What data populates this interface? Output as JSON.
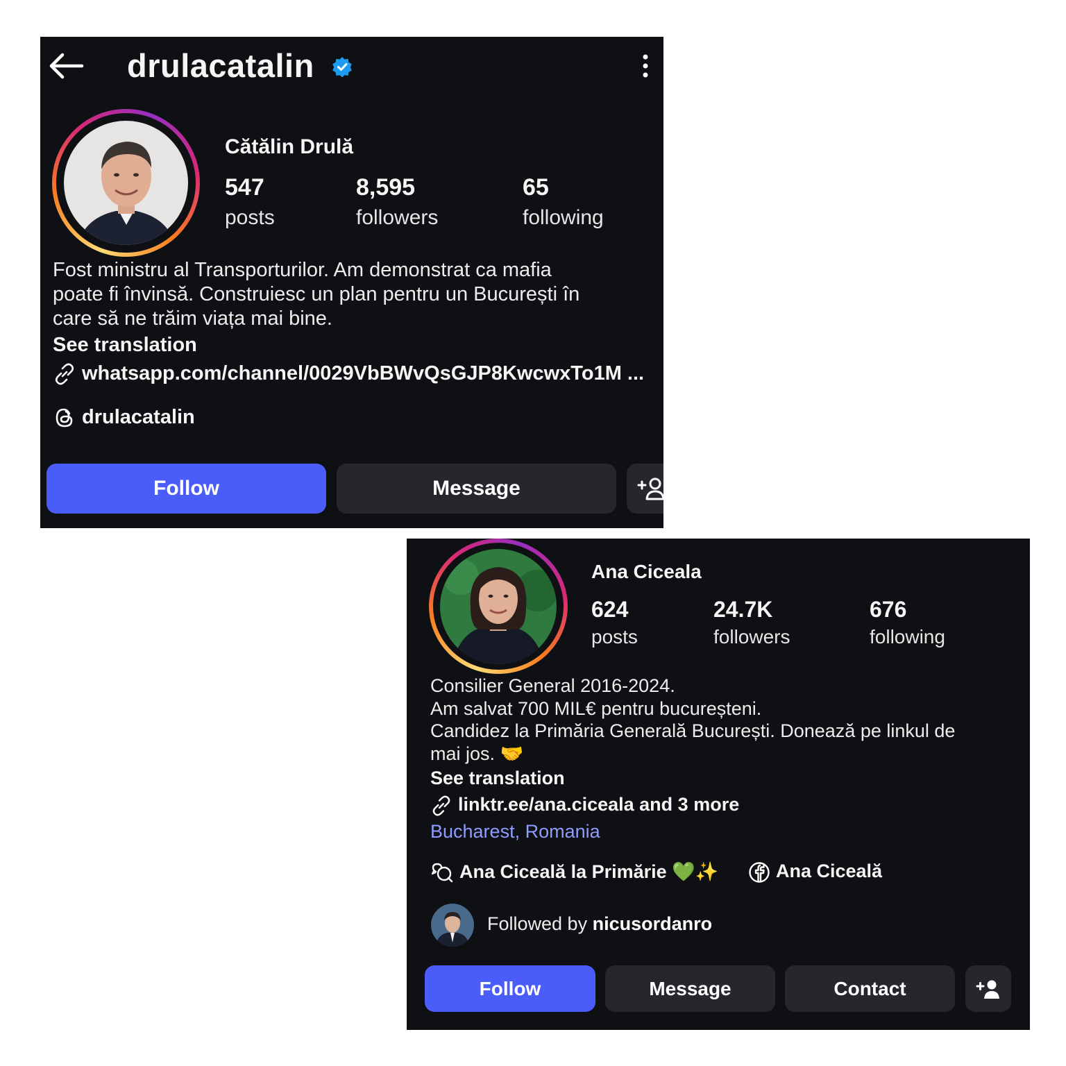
{
  "profile1": {
    "username": "drulacatalin",
    "full_name": "Cătălin Drulă",
    "stats": [
      {
        "value": "547",
        "label": "posts"
      },
      {
        "value": "8,595",
        "label": "followers"
      },
      {
        "value": "65",
        "label": "following"
      }
    ],
    "bio": [
      "Fost ministru al Transporturilor. Am demonstrat ca mafia",
      "poate fi învinsă. Construiesc un plan pentru un București în",
      "care să ne trăim viața mai bine."
    ],
    "see_translation": "See translation",
    "link": "whatsapp.com/channel/0029VbBWvQsGJP8KwcwxTo1M ...",
    "threads_handle": "drulacatalin",
    "follow_label": "Follow",
    "message_label": "Message",
    "icons": [
      "back-arrow-icon",
      "verified-badge-icon",
      "more-vertical-icon",
      "link-icon",
      "threads-icon",
      "add-person-icon"
    ]
  },
  "profile2": {
    "full_name": "Ana Ciceala",
    "stats": [
      {
        "value": "624",
        "label": "posts"
      },
      {
        "value": "24.7K",
        "label": "followers"
      },
      {
        "value": "676",
        "label": "following"
      }
    ],
    "bio": [
      "Consilier General 2016-2024.",
      "Am salvat 700 MIL€ pentru bucureșteni.",
      "Candidez la Primăria Generală București. Donează pe linkul de",
      "mai jos. 🤝"
    ],
    "see_translation": "See translation",
    "link": "linktr.ee/ana.ciceala and 3 more",
    "location": "Bucharest, Romania",
    "community_label": "Ana Ciceală la Primărie 💚✨",
    "facebook_label": "Ana Ciceală",
    "followed_by_prefix": "Followed by ",
    "followed_by_user": "nicusordanro",
    "follow_label": "Follow",
    "message_label": "Message",
    "contact_label": "Contact",
    "icons": [
      "link-icon",
      "chat-community-icon",
      "facebook-icon",
      "add-person-icon"
    ]
  },
  "colors": {
    "panel_bg": "#0f1014",
    "primary_button": "#4a5df9",
    "secondary_button": "#25272d",
    "location_link": "#8f9cff",
    "verified": "#1d9bf0"
  }
}
